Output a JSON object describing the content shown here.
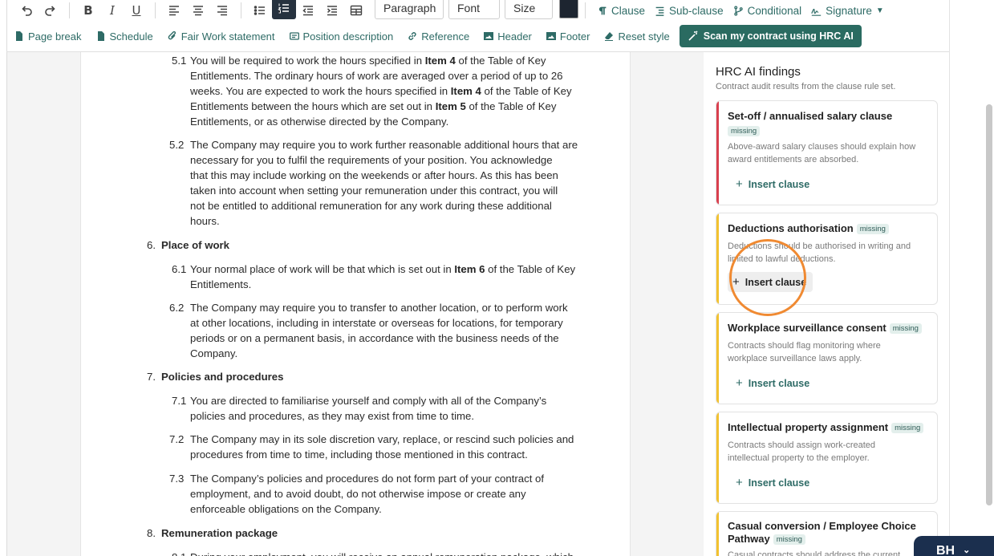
{
  "toolbar": {
    "paragraph_select": "Paragraph",
    "font_select": "Font",
    "size_select": "Size",
    "clause": "Clause",
    "sub_clause": "Sub-clause",
    "conditional": "Conditional",
    "signature": "Signature",
    "text_color": "#1d2530"
  },
  "toolbar2": {
    "page_break": "Page break",
    "schedule": "Schedule",
    "fair_work": "Fair Work statement",
    "position_description": "Position description",
    "reference": "Reference",
    "header": "Header",
    "footer": "Footer",
    "reset_style": "Reset style",
    "scan_button": "Scan my contract using HRC AI"
  },
  "document": {
    "c51": {
      "num": "5.1",
      "l1a": "You will be required to work the hours specified in ",
      "l1b": "Item 4",
      "l1c": " of the Table of Key",
      "l2": "Entitlements.  The ordinary hours of work are averaged over a period of up to 26",
      "l3a": "weeks.  You are expected to work the hours specified in ",
      "l3b": "Item 4",
      "l3c": " of the Table of Key",
      "l4a": "Entitlements between the hours which are set out in ",
      "l4b": "Item 5",
      "l4c": " of the Table of Key",
      "l5": "Entitlements, or as otherwise directed by the Company."
    },
    "c52": {
      "num": "5.2",
      "l1": "The Company may require you to work further reasonable additional hours that are",
      "l2": "necessary for you to fulfil the requirements of your position.  You acknowledge",
      "l3": "that this may include working on the weekends or after hours. As this has been",
      "l4": "taken into account  when setting your remuneration under this contract, you will",
      "l5": "not be entitled to additional remuneration for any work during these additional",
      "l6": "hours."
    },
    "h6": {
      "num": "6.",
      "title": "Place of work"
    },
    "c61": {
      "num": "6.1",
      "l1a": "Your normal place of work will be that which is set out in ",
      "l1b": "Item 6",
      "l1c": " of the Table of Key",
      "l2": "Entitlements."
    },
    "c62": {
      "num": "6.2",
      "l1": "The Company may require you to transfer to another location, or to perform work",
      "l2": "at other locations, including in interstate or overseas for locations, for temporary",
      "l3": "periods or on a permanent basis, in accordance with the business needs of the",
      "l4": "Company."
    },
    "h7": {
      "num": "7.",
      "title": "Policies and procedures"
    },
    "c71": {
      "num": "7.1",
      "l1": "You are directed to familiarise yourself and comply with all of the Company’s",
      "l2": "policies and procedures, as they may exist from time to time."
    },
    "c72": {
      "num": "7.2",
      "l1": "The Company may in its sole discretion vary, replace, or rescind such policies and",
      "l2": "procedures from time to time, including those mentioned in this contract."
    },
    "c73": {
      "num": "7.3",
      "l1": "The Company’s policies and procedures do not form part of your contract of",
      "l2": "employment, and to avoid doubt, do not otherwise impose or create any",
      "l3": "enforceable obligations on the Company."
    },
    "h8": {
      "num": "8.",
      "title": "Remuneration package"
    },
    "c81": {
      "num": "8.1",
      "l1": "During your employment, you will receive an annual remuneration package, which"
    }
  },
  "panel": {
    "title": "HRC AI findings",
    "subtitle": "Contract audit results from the clause rule set.",
    "insert_label": "Insert clause",
    "cards": [
      {
        "title": "Set-off / annualised salary clause",
        "badge": "missing",
        "desc1": "Above-award salary clauses should explain how",
        "desc2": "award entitlements are absorbed.",
        "accent": "#d9404f"
      },
      {
        "title": "Deductions authorisation",
        "badge": "missing",
        "desc1": "Deductions should be authorised in writing and",
        "desc2": "limited to lawful deductions.",
        "accent": "#f2c230"
      },
      {
        "title": "Workplace surveillance consent",
        "badge": "missing",
        "desc1": "Contracts should flag monitoring where",
        "desc2": "workplace surveillance laws apply.",
        "accent": "#f2c230"
      },
      {
        "title": "Intellectual property assignment",
        "badge": "missing",
        "desc1": "Contracts should assign work-created",
        "desc2": "intellectual property to the employer.",
        "accent": "#f2c230"
      },
      {
        "title1": "Casual conversion / Employee Choice",
        "title2": "Pathway",
        "badge": "missing",
        "desc1": "Casual contracts should address the current",
        "accent": "#f2c230"
      }
    ]
  },
  "chat": {
    "label": "BH"
  }
}
